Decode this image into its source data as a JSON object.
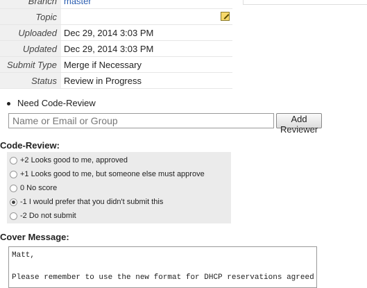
{
  "info": {
    "rows": [
      {
        "label": "Branch",
        "value": "master"
      },
      {
        "label": "Topic",
        "value": ""
      },
      {
        "label": "Uploaded",
        "value": "Dec 29, 2014 3:03 PM"
      },
      {
        "label": "Updated",
        "value": "Dec 29, 2014 3:03 PM"
      },
      {
        "label": "Submit Type",
        "value": "Merge if Necessary"
      },
      {
        "label": "Status",
        "value": "Review in Progress"
      }
    ]
  },
  "needs": {
    "item": "Need Code-Review"
  },
  "reviewer": {
    "placeholder": "Name or Email or Group",
    "button": "Add Reviewer"
  },
  "code_review": {
    "label": "Code-Review:",
    "options": [
      {
        "label": "+2 Looks good to me, approved",
        "checked": false
      },
      {
        "label": "+1 Looks good to me, but someone else must approve",
        "checked": false
      },
      {
        "label": "0 No score",
        "checked": false
      },
      {
        "label": "-1 I would prefer that you didn't submit this",
        "checked": true
      },
      {
        "label": "-2 Do not submit",
        "checked": false
      }
    ]
  },
  "cover": {
    "label": "Cover Message:",
    "text": "Matt,\n\nPlease remember to use the new format for DHCP reservations agreed"
  }
}
